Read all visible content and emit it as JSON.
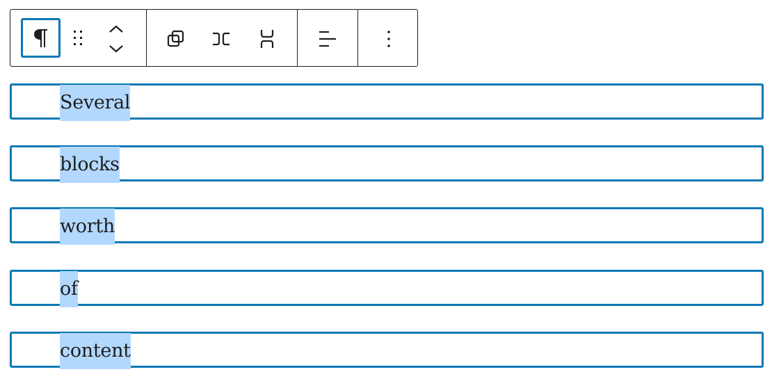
{
  "toolbar": {
    "buttons": [
      {
        "name": "paragraph",
        "icon": "pilcrow-icon",
        "active": true
      },
      {
        "name": "drag",
        "icon": "drag-handle-icon"
      },
      {
        "name": "move-up",
        "icon": "chevron-up-icon"
      },
      {
        "name": "move-down",
        "icon": "chevron-down-icon"
      },
      {
        "name": "group",
        "icon": "group-icon"
      },
      {
        "name": "row",
        "icon": "row-icon"
      },
      {
        "name": "stack",
        "icon": "stack-icon"
      },
      {
        "name": "align",
        "icon": "align-left-icon"
      },
      {
        "name": "more-options",
        "icon": "more-vertical-icon"
      }
    ],
    "accent_color": "#0a79b5"
  },
  "blocks": [
    {
      "text": "Several"
    },
    {
      "text": "blocks"
    },
    {
      "text": "worth"
    },
    {
      "text": "of"
    },
    {
      "text": "content"
    }
  ],
  "colors": {
    "selection_highlight": "#b3d8fd",
    "block_border": "#0a79b5",
    "text": "#1e1e1e"
  }
}
